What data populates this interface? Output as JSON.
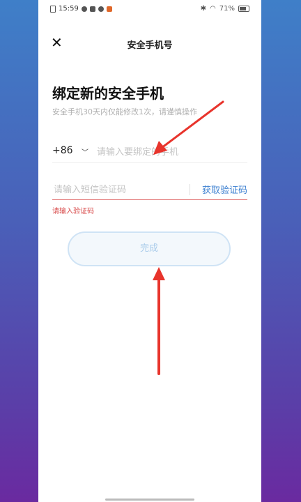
{
  "status_bar": {
    "time": "15:59",
    "battery": "71%"
  },
  "header": {
    "title": "安全手机号",
    "close_icon": "close-icon"
  },
  "heading": "绑定新的安全手机",
  "subtext": "安全手机30天内仅能修改1次，请谨慎操作",
  "phone_field": {
    "country_code": "+86",
    "placeholder": "请输入要绑定的手机"
  },
  "code_field": {
    "placeholder": "请输入短信验证码",
    "get_code_label": "获取验证码"
  },
  "error_text": "请输入验证码",
  "done_button": "完成",
  "colors": {
    "link": "#3b7fd0",
    "error": "#d84a4a",
    "annotation_arrow": "#e8342c"
  }
}
